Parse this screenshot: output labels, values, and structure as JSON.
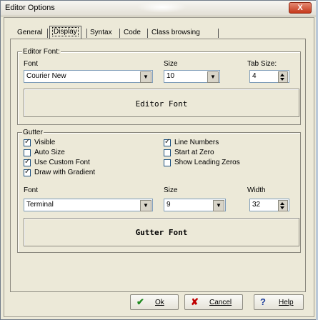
{
  "window": {
    "title": "Editor Options",
    "close_label": "X"
  },
  "tabs": [
    {
      "label": "General",
      "selected": false
    },
    {
      "label": "Display",
      "selected": true
    },
    {
      "label": "Syntax",
      "selected": false
    },
    {
      "label": "Code",
      "selected": false
    },
    {
      "label": "Class browsing",
      "selected": false
    }
  ],
  "editor_font": {
    "group_title": "Editor Font:",
    "font_label": "Font",
    "font_value": "Courier New",
    "size_label": "Size",
    "size_value": "10",
    "tabsize_label": "Tab Size:",
    "tabsize_value": "4",
    "preview_text": "Editor Font"
  },
  "gutter": {
    "group_title": "Gutter",
    "options": {
      "visible": {
        "label": "Visible",
        "checked": true
      },
      "auto_size": {
        "label": "Auto Size",
        "checked": false
      },
      "use_custom_font": {
        "label": "Use Custom Font",
        "checked": true
      },
      "draw_with_gradient": {
        "label": "Draw with Gradient",
        "checked": true
      },
      "line_numbers": {
        "label": "Line Numbers",
        "checked": true
      },
      "start_at_zero": {
        "label": "Start at Zero",
        "checked": false
      },
      "show_leading_zeros": {
        "label": "Show Leading Zeros",
        "checked": false
      }
    },
    "font_label": "Font",
    "font_value": "Terminal",
    "size_label": "Size",
    "size_value": "9",
    "width_label": "Width",
    "width_value": "32",
    "preview_text": "Gutter Font"
  },
  "buttons": {
    "ok": {
      "label": "Ok",
      "icon": "checkmark-icon"
    },
    "cancel": {
      "label": "Cancel",
      "icon": "x-cross-icon"
    },
    "help": {
      "label": "Help",
      "icon": "question-mark-icon"
    }
  }
}
